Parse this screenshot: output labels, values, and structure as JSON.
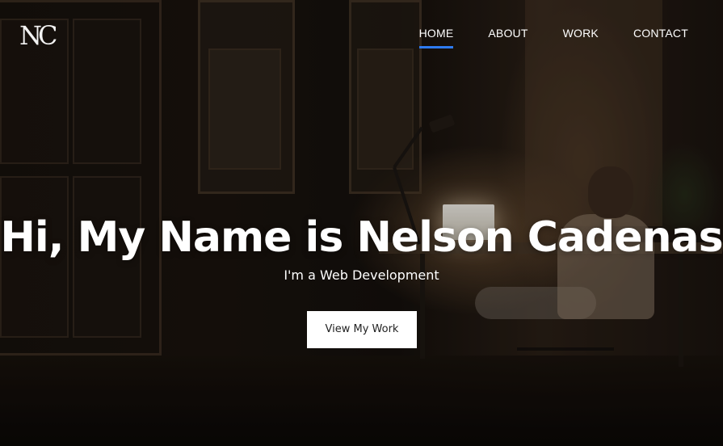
{
  "brand": {
    "logo_text": "NC"
  },
  "nav": {
    "items": [
      {
        "label": "HOME",
        "active": true
      },
      {
        "label": "ABOUT",
        "active": false
      },
      {
        "label": "WORK",
        "active": false
      },
      {
        "label": "CONTACT",
        "active": false
      }
    ]
  },
  "hero": {
    "headline": "Hi, My Name is Nelson Cadenas",
    "subheadline": "I'm a Web Development",
    "cta_label": "View My Work"
  },
  "colors": {
    "accent": "#2e7bf0",
    "text": "#ffffff",
    "button_bg": "#ffffff",
    "button_text": "#222222"
  }
}
